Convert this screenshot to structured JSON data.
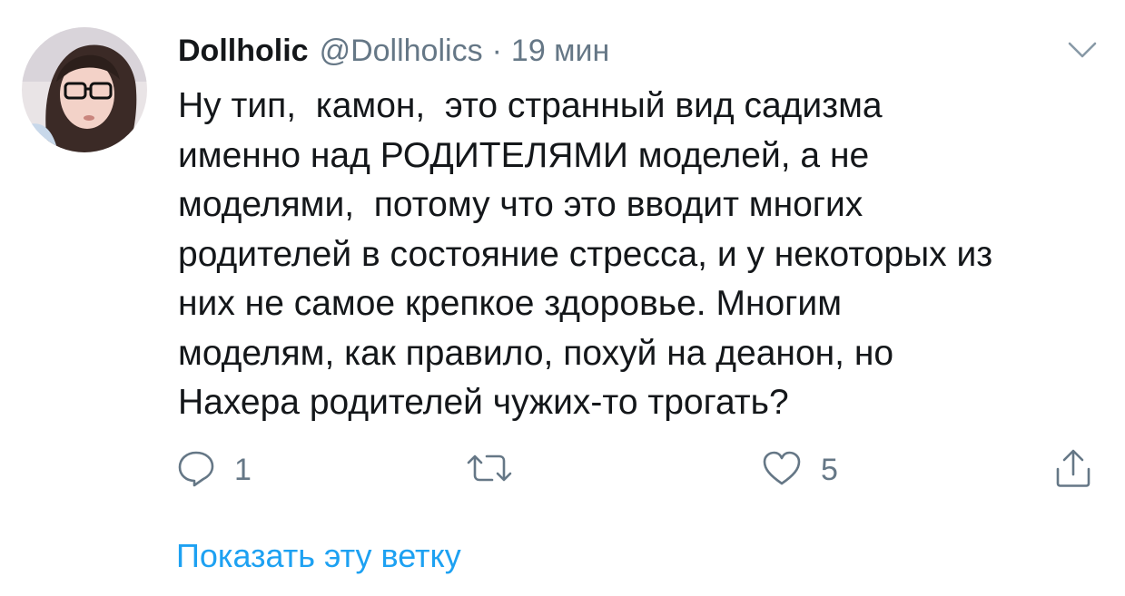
{
  "tweet": {
    "display_name": "Dollholic",
    "handle": "@Dollholics",
    "separator": "·",
    "time": "19 мин",
    "text": "Ну тип,  камон,  это странный вид садизма\nименно над РОДИТЕЛЯМИ моделей, а не\nмоделями,  потому что это вводит многих\nродителей в состояние стресса, и у некоторых из\nних не самое крепкое здоровье. Многим\nмоделям, как правило, похуй на деанон, но\nНахера родителей чужих-то трогать?",
    "actions": {
      "reply_icon": "reply-icon",
      "reply_count": "1",
      "retweet_icon": "retweet-icon",
      "like_icon": "heart-icon",
      "like_count": "5",
      "share_icon": "share-icon"
    },
    "show_thread": "Показать эту ветку"
  },
  "colors": {
    "text": "#14171a",
    "secondary": "#657786",
    "link": "#1da1f2",
    "background": "#ffffff"
  }
}
